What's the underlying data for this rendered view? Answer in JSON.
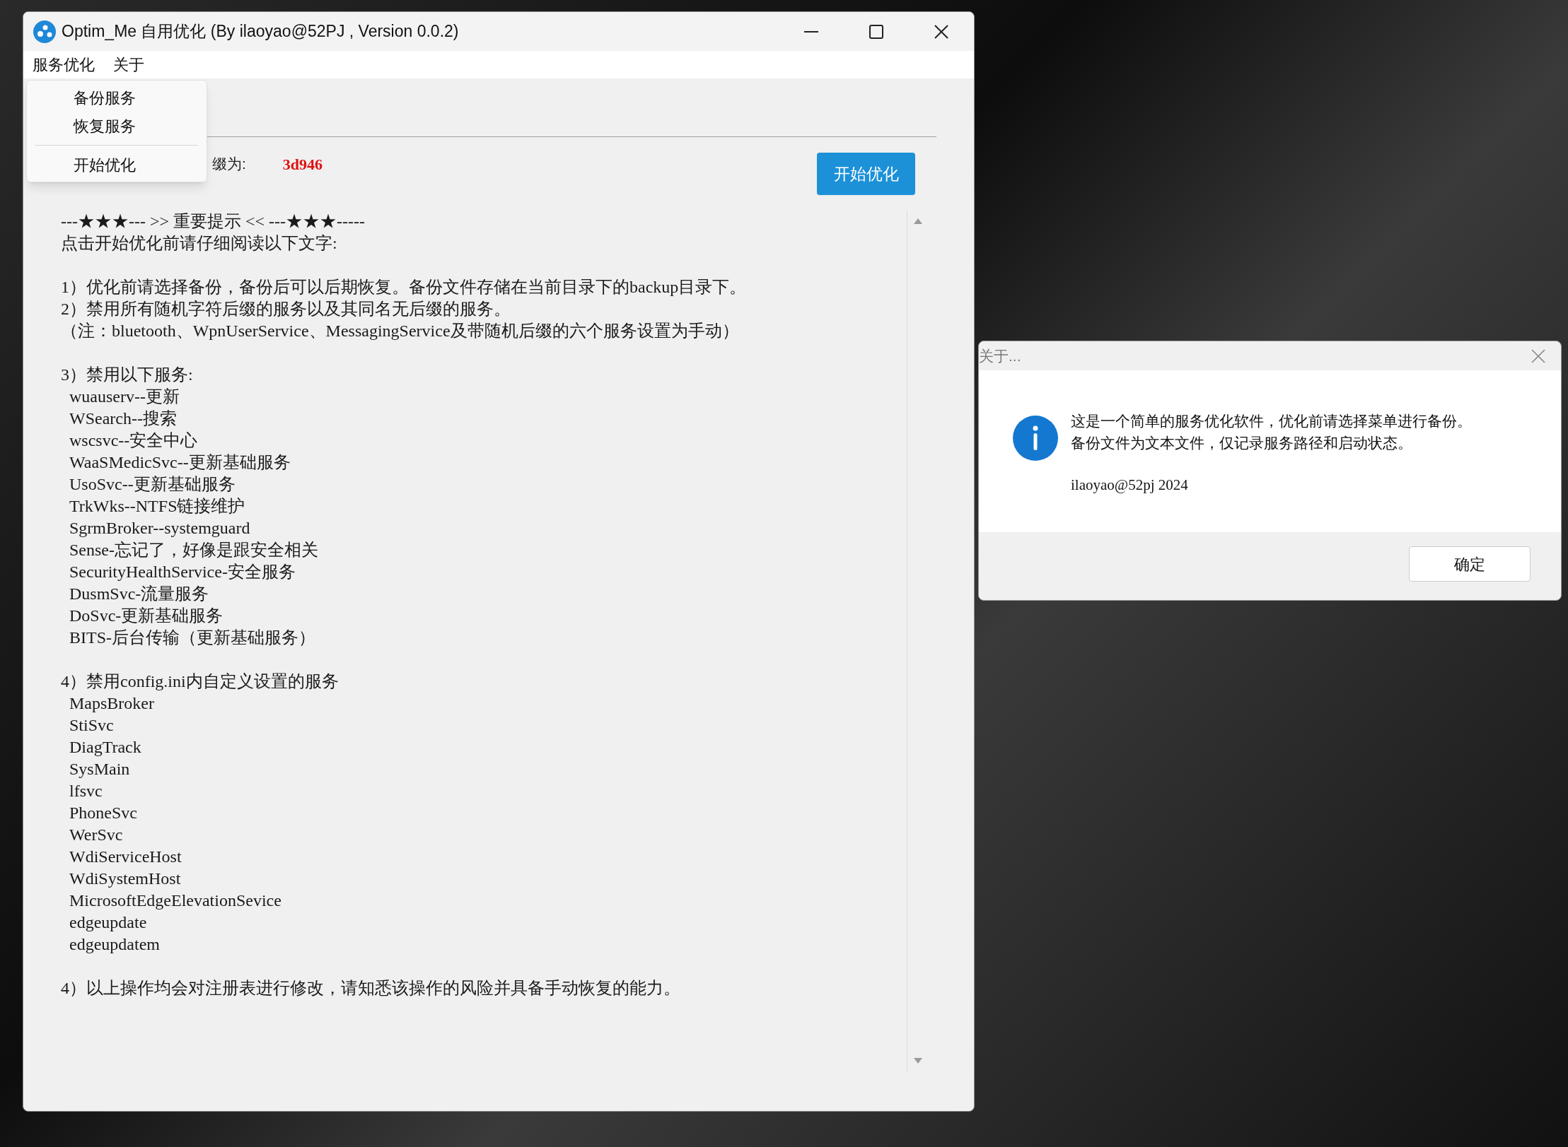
{
  "window": {
    "title": "Optim_Me 自用优化 (By ilaoyao@52PJ , Version 0.0.2)"
  },
  "menu": [
    {
      "label": "服务优化"
    },
    {
      "label": "关于"
    }
  ],
  "dropdown": {
    "items": [
      {
        "kind": "item",
        "label": "备份服务"
      },
      {
        "kind": "item",
        "label": "恢复服务"
      },
      {
        "kind": "separator"
      },
      {
        "kind": "item",
        "label": "开始优化"
      }
    ]
  },
  "suffix": {
    "label": "缀为:",
    "value": "3d946"
  },
  "start_button": "开始优化",
  "notice": [
    {
      "lines": [
        "---★★★--- >> 重要提示 << ---★★★-----",
        "点击开始优化前请仔细阅读以下文字:"
      ]
    },
    {
      "lines": [
        "1）优化前请选择备份，备份后可以后期恢复。备份文件存储在当前目录下的backup目录下。",
        "2）禁用所有随机字符后缀的服务以及其同名无后缀的服务。",
        "（注：bluetooth、WpnUserService、MessagingService及带随机后缀的六个服务设置为手动）"
      ]
    },
    {
      "lines": [
        "3）禁用以下服务:"
      ],
      "items": [
        "wuauserv--更新",
        "WSearch--搜索",
        "wscsvc--安全中心",
        "WaaSMedicSvc--更新基础服务",
        "UsoSvc--更新基础服务",
        "TrkWks--NTFS链接维护",
        "SgrmBroker--systemguard",
        "Sense-忘记了，好像是跟安全相关",
        "SecurityHealthService-安全服务",
        "DusmSvc-流量服务",
        "DoSvc-更新基础服务",
        "BITS-后台传输（更新基础服务）"
      ]
    },
    {
      "lines": [
        "4）禁用config.ini内自定义设置的服务"
      ],
      "items": [
        "MapsBroker",
        "StiSvc",
        "DiagTrack",
        "SysMain",
        "lfsvc",
        "PhoneSvc",
        "WerSvc",
        "WdiServiceHost",
        "WdiSystemHost",
        "MicrosoftEdgeElevationSevice",
        "edgeupdate",
        "edgeupdatem"
      ]
    },
    {
      "lines": [
        "4）以上操作均会对注册表进行修改，请知悉该操作的风险并具备手动恢复的能力。"
      ]
    }
  ],
  "dialog": {
    "title": "关于...",
    "lines": [
      "这是一个简单的服务优化软件，优化前请选择菜单进行备份。",
      "备份文件为文本文件，仅记录服务路径和启动状态。"
    ],
    "credit": "ilaoyao@52pj 2024",
    "ok_button": "确定"
  }
}
